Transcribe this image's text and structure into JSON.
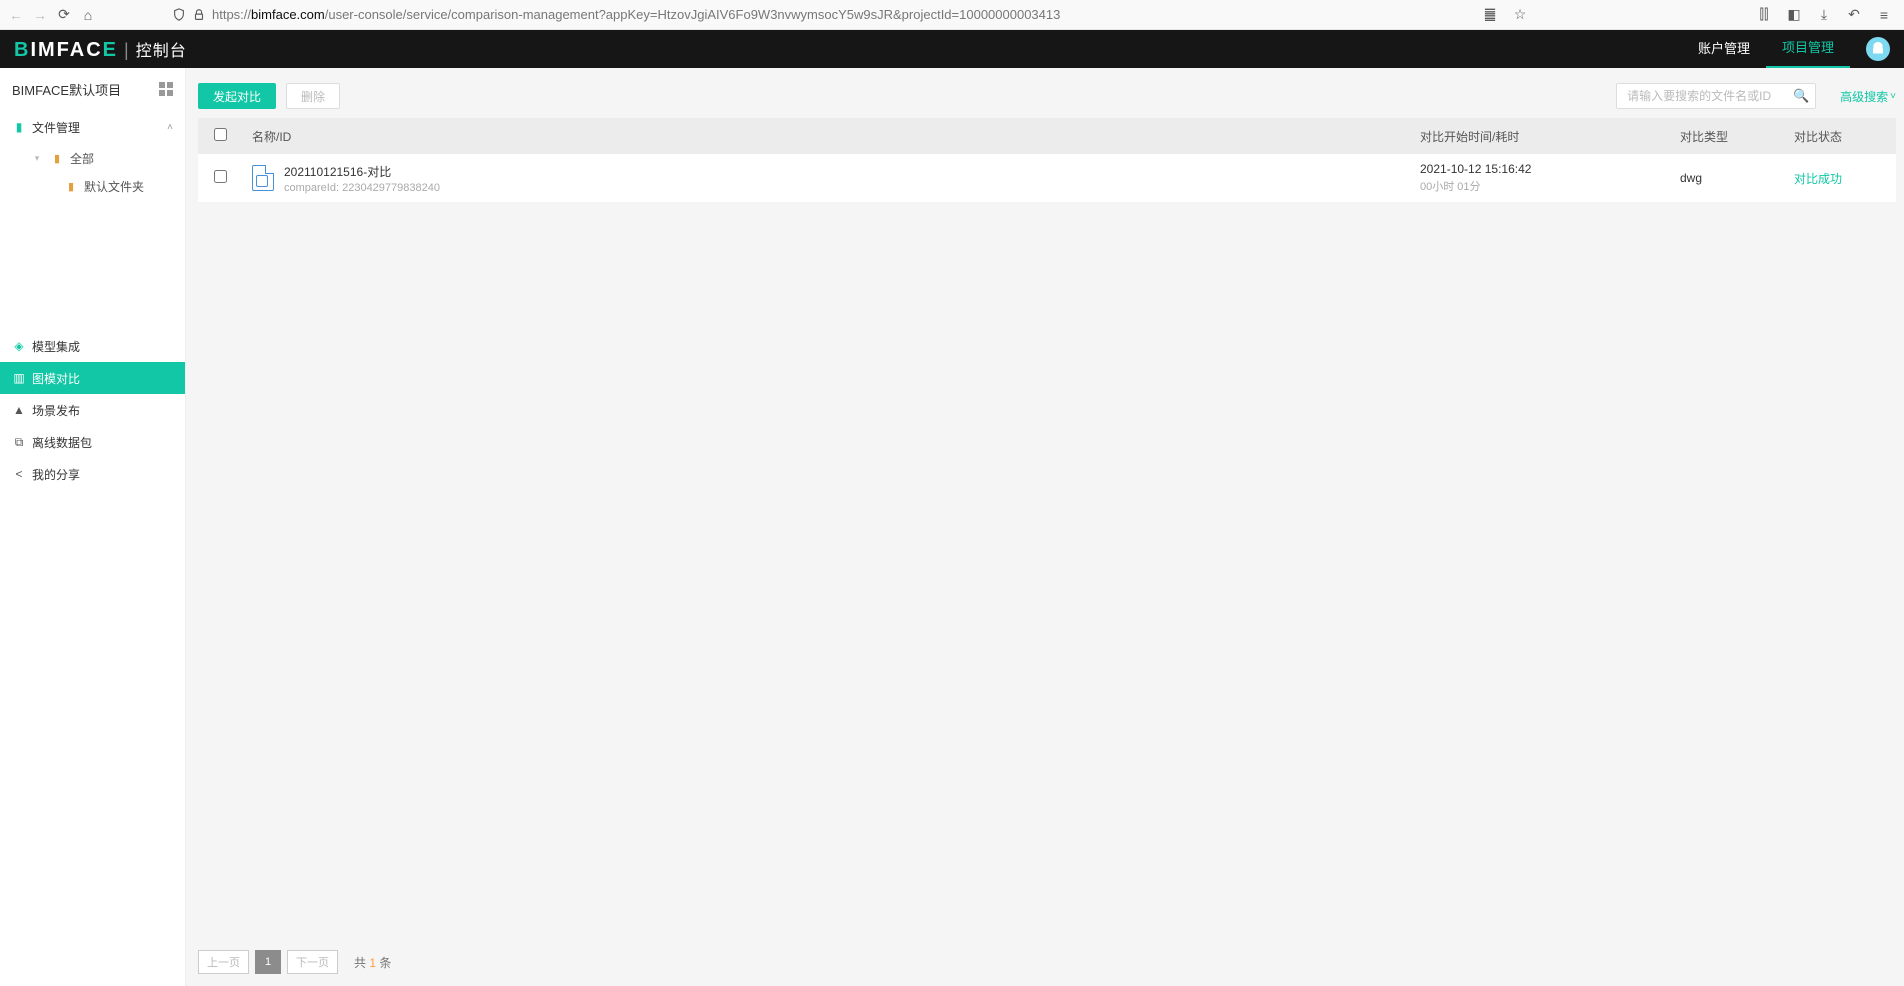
{
  "browser": {
    "url_host": "bimface.com",
    "url_prefix": "https://",
    "url_path": "/user-console/service/comparison-management?appKey=HtzovJgiAIV6Fo9W3nvwymsocY5w9sJR&projectId=10000000003413"
  },
  "header": {
    "logo_text": "BIMFACE",
    "logo_sub": "控制台",
    "nav": {
      "account": "账户管理",
      "project": "项目管理"
    }
  },
  "sidebar": {
    "project_name": "BIMFACE默认项目",
    "file_mgmt": "文件管理",
    "tree": {
      "all": "全部",
      "default_folder": "默认文件夹"
    },
    "menu": {
      "model_integrate": "模型集成",
      "drawing_compare": "图模对比",
      "scene_publish": "场景发布",
      "offline_pack": "离线数据包",
      "my_share": "我的分享"
    }
  },
  "toolbar": {
    "start_compare": "发起对比",
    "delete": "删除",
    "search_placeholder": "请输入要搜索的文件名或ID",
    "adv_search": "高级搜索"
  },
  "table": {
    "headers": {
      "name": "名称/ID",
      "time": "对比开始时间/耗时",
      "type": "对比类型",
      "status": "对比状态"
    },
    "rows": [
      {
        "name": "202110121516-对比",
        "id_label": "compareId:",
        "id": "2230429779838240",
        "time": "2021-10-12 15:16:42",
        "duration": "00小时 01分",
        "type": "dwg",
        "status": "对比成功"
      }
    ]
  },
  "pager": {
    "prev": "上一页",
    "next": "下一页",
    "current": "1",
    "total_prefix": "共",
    "total_count": "1",
    "total_suffix": "条"
  }
}
